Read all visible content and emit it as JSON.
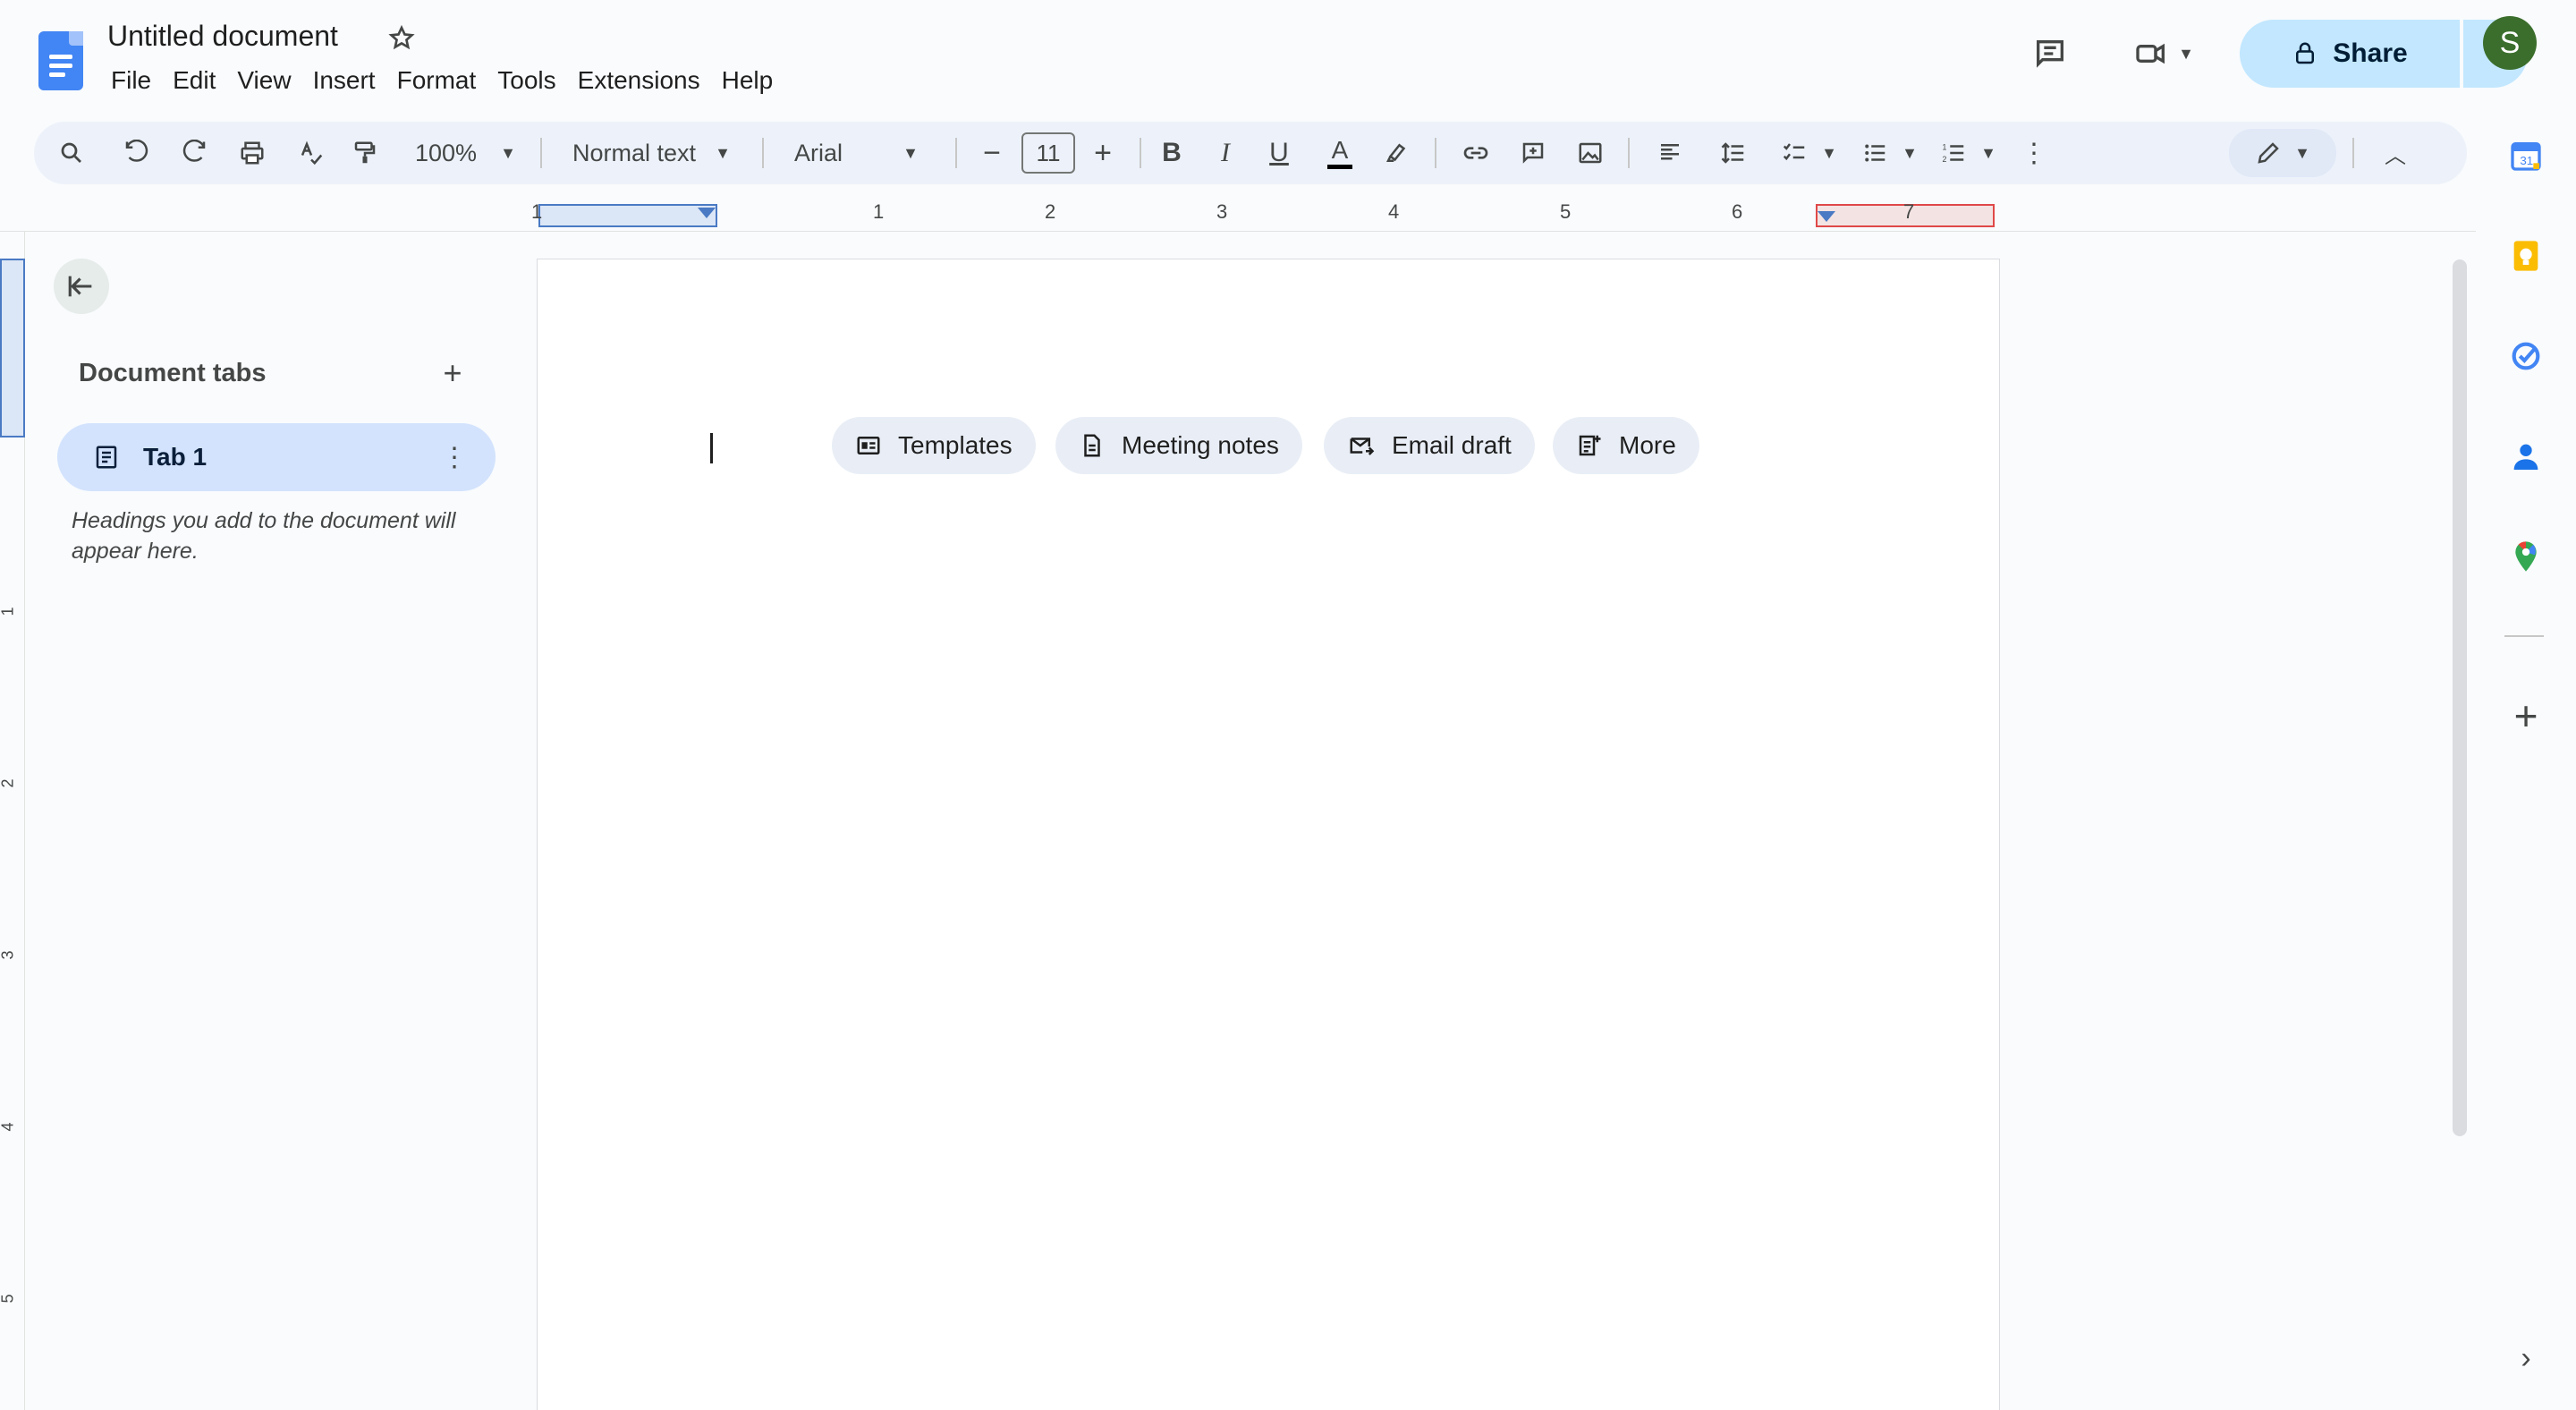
{
  "header": {
    "doc_title": "Untitled document",
    "menu": [
      "File",
      "Edit",
      "View",
      "Insert",
      "Format",
      "Tools",
      "Extensions",
      "Help"
    ],
    "share_label": "Share",
    "avatar_initial": "S"
  },
  "toolbar": {
    "zoom": "100%",
    "style": "Normal text",
    "font": "Arial",
    "font_size": "11"
  },
  "ruler": {
    "h_numbers": [
      "1",
      "1",
      "2",
      "3",
      "4",
      "5",
      "6",
      "7"
    ],
    "v_numbers": [
      "1",
      "2",
      "3",
      "4",
      "5"
    ]
  },
  "outline": {
    "heading": "Document tabs",
    "tab_label": "Tab 1",
    "hint": "Headings you add to the document will appear here."
  },
  "document": {
    "chips": [
      "Templates",
      "Meeting notes",
      "Email draft",
      "More"
    ]
  },
  "colors": {
    "accent": "#0b57d0",
    "share_bg": "#c2e7ff",
    "tab_bg": "#d3e3fd",
    "chip_bg": "#e9eef6",
    "toolbar_bg": "#edf2fa"
  }
}
